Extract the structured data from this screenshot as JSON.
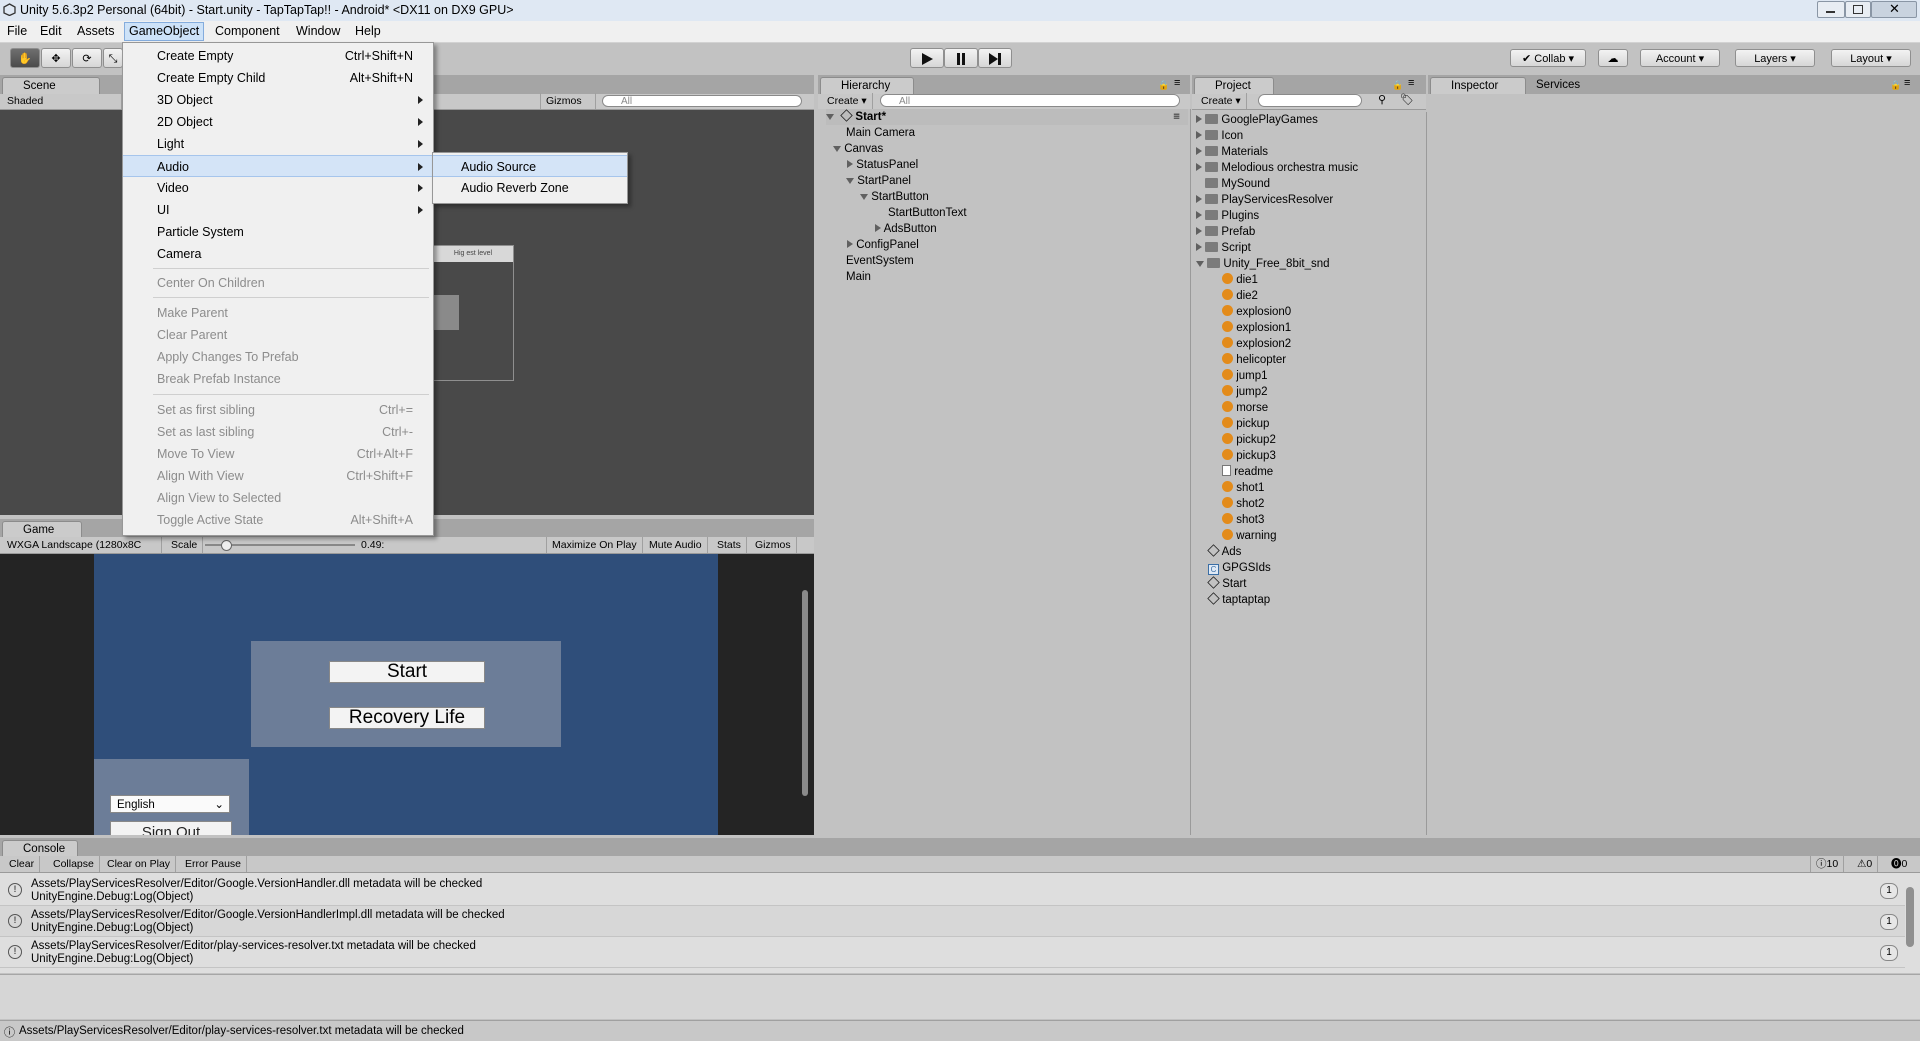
{
  "window": {
    "title": "Unity 5.6.3p2 Personal (64bit) - Start.unity - TapTapTap!! - Android* <DX11 on DX9 GPU>"
  },
  "menubar": [
    "File",
    "Edit",
    "Assets",
    "GameObject",
    "Component",
    "Window",
    "Help"
  ],
  "toolbar": {
    "collab": "Collab",
    "account": "Account",
    "layers": "Layers",
    "layout": "Layout"
  },
  "gameobject_menu": {
    "items": [
      {
        "label": "Create Empty",
        "shortcut": "Ctrl+Shift+N"
      },
      {
        "label": "Create Empty Child",
        "shortcut": "Alt+Shift+N"
      },
      {
        "label": "3D Object"
      },
      {
        "label": "2D Object"
      },
      {
        "label": "Light"
      },
      {
        "label": "Audio"
      },
      {
        "label": "Video"
      },
      {
        "label": "UI"
      },
      {
        "label": "Particle System"
      },
      {
        "label": "Camera"
      },
      {
        "label": "Center On Children"
      },
      {
        "label": "Make Parent"
      },
      {
        "label": "Clear Parent"
      },
      {
        "label": "Apply Changes To Prefab"
      },
      {
        "label": "Break Prefab Instance"
      },
      {
        "label": "Set as first sibling",
        "shortcut": "Ctrl+="
      },
      {
        "label": "Set as last sibling",
        "shortcut": "Ctrl+-"
      },
      {
        "label": "Move To View",
        "shortcut": "Ctrl+Alt+F"
      },
      {
        "label": "Align With View",
        "shortcut": "Ctrl+Shift+F"
      },
      {
        "label": "Align View to Selected"
      },
      {
        "label": "Toggle Active State",
        "shortcut": "Alt+Shift+A"
      }
    ],
    "audio_submenu": [
      "Audio Source",
      "Audio Reverb Zone"
    ]
  },
  "scene": {
    "tab": "Scene",
    "shading": "Shaded",
    "gizmos": "Gizmos",
    "search": "All",
    "panel_text": "Hig est level"
  },
  "game": {
    "tab": "Game",
    "resolution": "WXGA Landscape (1280x8C",
    "scale_label": "Scale",
    "scale_value": "0.49:",
    "maximize": "Maximize On Play",
    "mute": "Mute Audio",
    "stats": "Stats",
    "gizmos": "Gizmos",
    "start_button": "Start",
    "recovery_button": "Recovery Life",
    "language": "English",
    "cut_button": "Sign Out"
  },
  "hierarchy": {
    "tab": "Hierarchy",
    "create": "Create",
    "search": "All",
    "scene": "Start*",
    "items": [
      "Main Camera",
      "Canvas",
      "StatusPanel",
      "StartPanel",
      "StartButton",
      "StartButtonText",
      "AdsButton",
      "ConfigPanel",
      "EventSystem",
      "Main"
    ]
  },
  "project": {
    "tab": "Project",
    "create": "Create",
    "folders": [
      "GooglePlayGames",
      "Icon",
      "Materials",
      "Melodious orchestra music",
      "MySound",
      "PlayServicesResolver",
      "Plugins",
      "Prefab",
      "Script",
      "Unity_Free_8bit_snd"
    ],
    "sounds": [
      "die1",
      "die2",
      "explosion0",
      "explosion1",
      "explosion2",
      "helicopter",
      "jump1",
      "jump2",
      "morse",
      "pickup",
      "pickup2",
      "pickup3",
      "readme",
      "shot1",
      "shot2",
      "shot3",
      "warning"
    ],
    "assets": [
      "Ads",
      "GPGSIds",
      "Start",
      "taptaptap"
    ]
  },
  "inspector": {
    "tab": "Inspector",
    "services": "Services"
  },
  "console": {
    "tab": "Console",
    "clear": "Clear",
    "collapse": "Collapse",
    "clear_on_play": "Clear on Play",
    "error_pause": "Error Pause",
    "counts": {
      "info": "10",
      "warn": "0",
      "error": "0"
    },
    "entries": [
      {
        "line1": "Assets/PlayServicesResolver/Editor/Google.VersionHandler.dll metadata will be checked",
        "line2": "UnityEngine.Debug:Log(Object)",
        "count": "1"
      },
      {
        "line1": "Assets/PlayServicesResolver/Editor/Google.VersionHandlerImpl.dll metadata will be checked",
        "line2": "UnityEngine.Debug:Log(Object)",
        "count": "1"
      },
      {
        "line1": "Assets/PlayServicesResolver/Editor/play-services-resolver.txt metadata will be checked",
        "line2": "UnityEngine.Debug:Log(Object)",
        "count": "1"
      }
    ]
  },
  "statusbar": {
    "text": "Assets/PlayServicesResolver/Editor/play-services-resolver.txt metadata will be checked"
  },
  "colors": {
    "game_bg": "#2f4e7a",
    "menu_highlight": "#d4e4f7",
    "audio_icon": "#e38b1a"
  }
}
